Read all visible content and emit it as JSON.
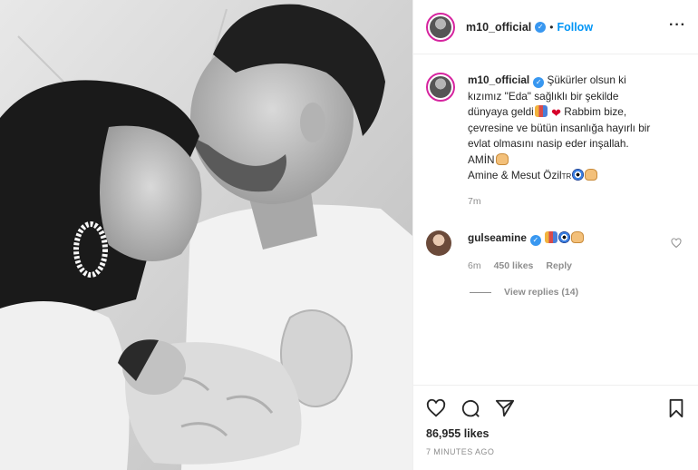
{
  "header": {
    "username": "m10_official",
    "separator": "•",
    "follow_label": "Follow",
    "more_icon": "more-horizontal-icon"
  },
  "caption": {
    "username": "m10_official",
    "lines": [
      "Şükürler olsun ki",
      "kızımız \"Eda\" sağlıklı bir şekilde",
      "dünyaya geldi",
      "Rabbim bize,",
      "çevresine ve bütün insanlığa hayırlı bir",
      "evlat olmasını nasip eder inşallah.",
      "AMİN",
      "Amine & Mesut Özil"
    ],
    "flag_text": "TR",
    "time": "7m"
  },
  "comment": {
    "username": "gulseamine",
    "time": "6m",
    "likes": "450 likes",
    "reply": "Reply",
    "view_replies": "View replies (14)"
  },
  "actions": {
    "likes_total": "86,955 likes",
    "post_time": "7 MINUTES AGO"
  },
  "colors": {
    "accent": "#0095f6",
    "verified": "#3897f0",
    "heart": "#d6002a",
    "muted": "#8e8e8e",
    "text": "#262626",
    "border": "#efefef"
  }
}
